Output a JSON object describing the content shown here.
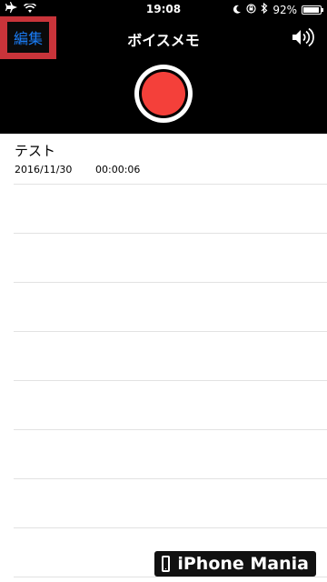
{
  "status_bar": {
    "time": "19:08",
    "battery": "92%",
    "battery_level": 0.92
  },
  "nav": {
    "edit_label": "編集",
    "title": "ボイスメモ"
  },
  "recordings": [
    {
      "title": "テスト",
      "date": "2016/11/30",
      "duration": "00:00:06"
    }
  ],
  "watermark": {
    "text": "iPhone Mania"
  },
  "colors": {
    "accent": "#1a7cf5",
    "record": "#f4403a",
    "highlight": "#c9343a"
  },
  "icons": [
    "airplane-icon",
    "wifi-icon",
    "moon-icon",
    "orientation-lock-icon",
    "bluetooth-icon",
    "battery-icon",
    "speaker-icon",
    "record-icon",
    "phone-icon"
  ]
}
